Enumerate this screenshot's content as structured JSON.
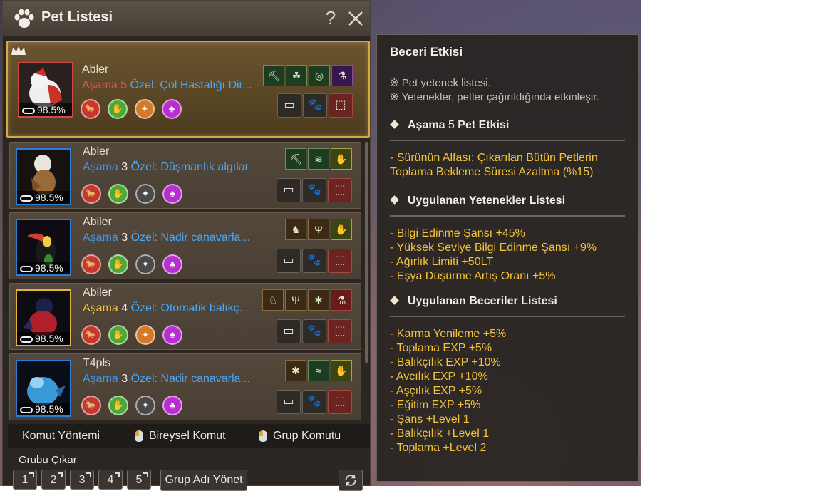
{
  "panel": {
    "title": "Pet Listesi",
    "help_label": "?",
    "pets": [
      {
        "name": "Abler",
        "tier_word": "Aşama",
        "tier_num": "5",
        "special": "Özel: Çöl Hastalığı Dir...",
        "stamina": "98.5%"
      },
      {
        "name": "Abler",
        "tier_word": "Aşama",
        "tier_num": "3",
        "special": "Özel: Düşmanlık algılar",
        "stamina": "98.5%"
      },
      {
        "name": "Abiler",
        "tier_word": "Aşama",
        "tier_num": "3",
        "special": "Özel: Nadir canavarla...",
        "stamina": "98.5%"
      },
      {
        "name": "Abiler",
        "tier_word": "Aşama",
        "tier_num": "4",
        "special": "Özel: Otomatik balıkç...",
        "stamina": "98.5%"
      },
      {
        "name": "T4pls",
        "tier_word": "Aşama",
        "tier_num": "3",
        "special": "Özel: Nadir canavarla...",
        "stamina": "98.5%"
      }
    ],
    "command_bar": {
      "method_label": "Komut Yöntemi",
      "individual_label": "Bireysel Komut",
      "group_label": "Grup Komutu"
    },
    "group_remove": "Grubu Çıkar",
    "group_slots": [
      "1",
      "2",
      "3",
      "4",
      "5"
    ],
    "group_name_manage": "Grup Adı Yönet"
  },
  "tooltip": {
    "title": "Beceri Etkisi",
    "notes": [
      "※ Pet yetenek listesi.",
      "※ Yetenekler, petler çağırıldığında etkinleşir."
    ],
    "tier_section": {
      "prefix": "Aşama",
      "num": "5",
      "suffix": "Pet Etkisi"
    },
    "tier_effect_lines": [
      "- Sürünün Alfası: Çıkarılan Bütün Petlerin",
      "Toplama Bekleme Süresi Azaltma (%15)"
    ],
    "abilities_heading": "Uygulanan Yetenekler Listesi",
    "abilities": [
      "- Bilgi Edinme Şansı +45%",
      "- Yüksek Seviye Bilgi Edinme Şansı +9%",
      "- Ağırlık Limiti +50LT",
      "- Eşya Düşürme Artış Oranı +5%"
    ],
    "skills_heading": "Uygulanan Beceriler Listesi",
    "skills": [
      "- Karma Yenileme +5%",
      "- Toplama EXP +5%",
      "- Balıkçılık EXP +10%",
      "- Avcılık EXP +10%",
      "- Aşçılık EXP +5%",
      "- Eğitim EXP +5%",
      "- Şans +Level 1",
      "- Balıkçılık +Level 1",
      "- Toplama +Level 2"
    ]
  },
  "colors": {
    "accent_gold": "#d2a849",
    "tier5": "#e6524a",
    "tier3": "#3a9af0",
    "tier4": "#f0c040",
    "effect_text": "#f3c33a"
  }
}
